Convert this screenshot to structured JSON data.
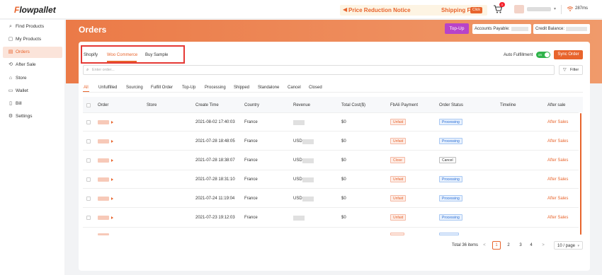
{
  "app": {
    "logo_text": "lowpallet",
    "logo_initial": "F"
  },
  "header": {
    "notice_text": "Price Reduction Notice",
    "notice_text2": "Shipping F",
    "notice_button": "Click",
    "cart_badge": "0",
    "ping": "287ms"
  },
  "sidebar": {
    "items": [
      {
        "label": "Find Products",
        "icon": "search-icon"
      },
      {
        "label": "My Products",
        "icon": "box-icon"
      },
      {
        "label": "Orders",
        "icon": "orders-icon"
      },
      {
        "label": "After Sale",
        "icon": "after-sale-icon"
      },
      {
        "label": "Store",
        "icon": "store-icon"
      },
      {
        "label": "Wallet",
        "icon": "wallet-icon"
      },
      {
        "label": "Bill",
        "icon": "bill-icon"
      },
      {
        "label": "Settings",
        "icon": "gear-icon"
      }
    ]
  },
  "page": {
    "title": "Orders",
    "topup_label": "Top-Up",
    "accounts_payable_label": "Accounts Payable:",
    "credit_balance_label": "Credit Balance:"
  },
  "store_tabs": [
    "Shopify",
    "Woo Commerce",
    "Buy Sample"
  ],
  "auto_fulfillment_label": "Auto Fulfillment",
  "toggle_label": "on",
  "sync_order_label": "Sync Order",
  "search": {
    "placeholder": "Enter order..."
  },
  "filter_label": "Filter",
  "status_tabs": [
    "All",
    "Unfulfilled",
    "Sourcing",
    "Fulfill Order",
    "Top-Up",
    "Processing",
    "Shipped",
    "Standalone",
    "Cancel",
    "Closed"
  ],
  "table": {
    "columns": [
      "Order",
      "Store",
      "Create Time",
      "Country",
      "Revenue",
      "Total Cost($)",
      "FbAli Payment",
      "Order Status",
      "Timeline",
      "After sale"
    ],
    "rows": [
      {
        "create_time": "2021-08-02 17:40:03",
        "country": "France",
        "revenue": "",
        "total_cost": "$0",
        "payment": "Unfaid",
        "status": "Processing",
        "after_sale": "After Sales"
      },
      {
        "create_time": "2021-07-28 18:48:05",
        "country": "France",
        "revenue": "USD",
        "total_cost": "$0",
        "payment": "Unfaid",
        "status": "Processing",
        "after_sale": "After Sales"
      },
      {
        "create_time": "2021-07-28 18:38:07",
        "country": "France",
        "revenue": "USD",
        "total_cost": "$0",
        "payment": "Close",
        "status": "Cancel",
        "after_sale": "After Sales"
      },
      {
        "create_time": "2021-07-28 18:31:10",
        "country": "France",
        "revenue": "USD",
        "total_cost": "$0",
        "payment": "Unfaid",
        "status": "Processing",
        "after_sale": "After Sales"
      },
      {
        "create_time": "2021-07-24 11:19:04",
        "country": "France",
        "revenue": "USD",
        "total_cost": "$0",
        "payment": "Unfaid",
        "status": "Processing",
        "after_sale": "After Sales"
      },
      {
        "create_time": "2021-07-23 19:12:03",
        "country": "France",
        "revenue": "",
        "total_cost": "$0",
        "payment": "Unfaid",
        "status": "Processing",
        "after_sale": "After Sales"
      }
    ]
  },
  "pagination": {
    "total": "Total 36 items",
    "prev": "<",
    "next": ">",
    "pages": [
      "1",
      "2",
      "3",
      "4"
    ],
    "page_size": "10 / page"
  }
}
